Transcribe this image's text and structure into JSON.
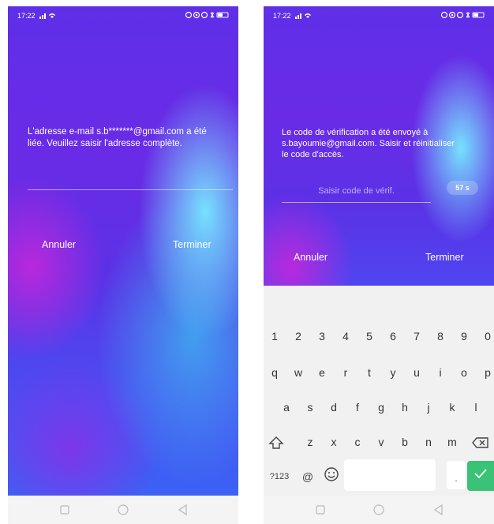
{
  "left_screen": {
    "status": {
      "time": "17:22",
      "icons": "signal, wifi, nfc, location, alarm, bluetooth, battery"
    },
    "prompt": "L'adresse e-mail s.b*******@gmail.com a été liée. Veuillez saisir l'adresse complète.",
    "email_input": {
      "value": "",
      "placeholder": ""
    },
    "cancel_label": "Annuler",
    "finish_label": "Terminer"
  },
  "right_screen": {
    "status": {
      "time": "17:22",
      "icons": "signal, wifi, nfc, location, alarm, bluetooth, battery"
    },
    "prompt": "Le code de vérification a été envoyé à s.bayoumie@gmail.com. Saisir et réinitialiser le code d'accès.",
    "code_input": {
      "value": "",
      "placeholder": "Saisir code de vérif."
    },
    "countdown": "57 s",
    "cancel_label": "Annuler",
    "finish_label": "Terminer",
    "keyboard": {
      "row_numbers": [
        "1",
        "2",
        "3",
        "4",
        "5",
        "6",
        "7",
        "8",
        "9",
        "0"
      ],
      "row_1": [
        "q",
        "w",
        "e",
        "r",
        "t",
        "y",
        "u",
        "i",
        "o",
        "p"
      ],
      "row_2": [
        "a",
        "s",
        "d",
        "f",
        "g",
        "h",
        "j",
        "k",
        "l"
      ],
      "row_3": [
        "z",
        "x",
        "c",
        "v",
        "b",
        "n",
        "m"
      ],
      "symbols_key": "?123",
      "at_key": "@",
      "period_key": "."
    }
  },
  "colors": {
    "accent_purple": "#6a2be6",
    "accent_cyan": "#78ebff",
    "enter_key_green": "#3ac276"
  }
}
